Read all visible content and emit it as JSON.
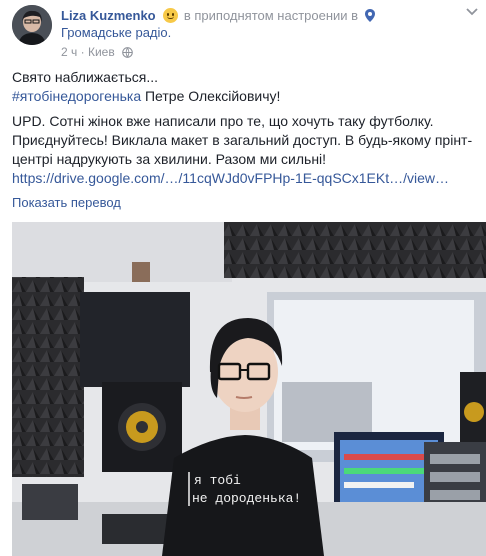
{
  "post": {
    "author": "Liza Kuzmenko",
    "feeling_text": "в приподнятом настроении в",
    "place": "Громадське радіо.",
    "time": "2 ч",
    "separator": "·",
    "location": "Киев",
    "line1": "Свято наближається...",
    "hashtag": "#ятобінедорогенька",
    "line2_rest": " Петре Олексійовичу!",
    "line3": "UPD. Сотні жінок вже написали про те, що хочуть таку футболку.",
    "line4": "Приєднуйтесь! Виклала макет в загальний доступ. В будь-якому прінт-",
    "line5": "центрі надрукують за хвилини. Разом ми сильні!",
    "link": "https://drive.google.com/…/11cqWJd0vFPHp-1E-qqSCx1EKt…/view…",
    "translate_label": "Показать перевод"
  },
  "photo": {
    "shirt_line1": "я тобі",
    "shirt_line2": "не дороденька!"
  },
  "colors": {
    "link": "#365899",
    "muted": "#90949c",
    "text": "#1d2129"
  },
  "icons": [
    "smile-emoji-icon",
    "location-pin-icon",
    "globe-icon",
    "chevron-down-icon"
  ]
}
